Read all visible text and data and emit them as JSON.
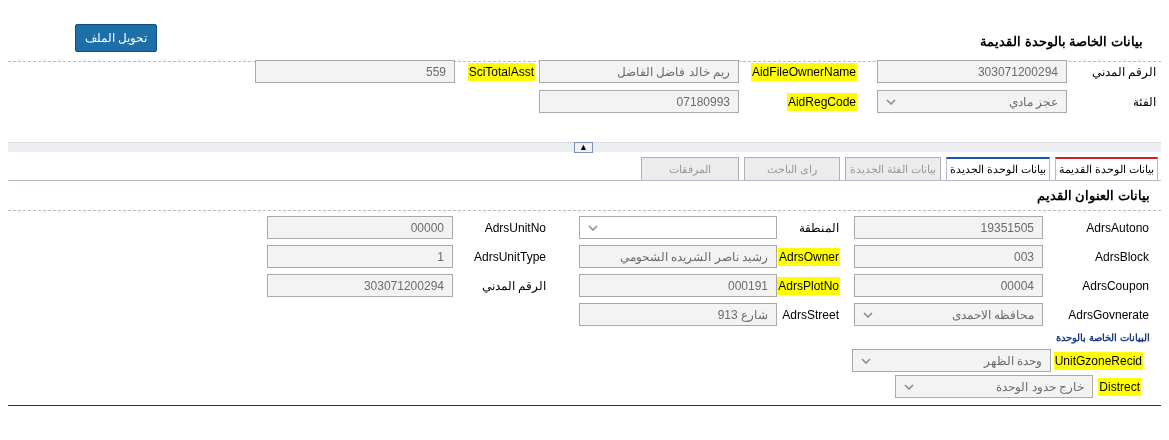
{
  "header": {
    "title": "بيانات الخاصة بالوحدة القديمة",
    "button": "تحويل الملف"
  },
  "top_rows": [
    [
      {
        "label": "الرقم المدني",
        "highlighted": false,
        "kind": "text",
        "value": "303071200294",
        "disabled": true
      },
      {
        "label": "AidFileOwnerName",
        "highlighted": true,
        "kind": "text",
        "value": "ريم خالد فاضل الفاضل",
        "disabled": true
      },
      {
        "label": "SciTotalAsst",
        "highlighted": true,
        "kind": "text",
        "value": "559",
        "disabled": true
      }
    ],
    [
      {
        "label": "الفئة",
        "highlighted": false,
        "kind": "select",
        "value": "عجز مادي",
        "disabled": true
      },
      {
        "label": "AidRegCode",
        "highlighted": true,
        "kind": "text",
        "value": "07180993",
        "disabled": true
      }
    ]
  ],
  "splitter_button": "▲",
  "tabs": [
    {
      "label": "بيانات الوحدة القديمة",
      "selected": true,
      "disabled": false
    },
    {
      "label": "بيانات الوحدة الجديدة",
      "selected": false,
      "disabled": false
    },
    {
      "label": "بيانات الفئة الجديدة",
      "selected": false,
      "disabled": true
    },
    {
      "label": "راى الباحث",
      "selected": false,
      "disabled": true
    },
    {
      "label": "المرفقات",
      "selected": false,
      "disabled": true
    }
  ],
  "section_title": "بيانات العنوان القديم",
  "address_rows": [
    [
      {
        "label": "AdrsAutono",
        "highlighted": false,
        "kind": "text",
        "value": "19351505",
        "disabled": true
      },
      {
        "label": "المنطقة",
        "highlighted": false,
        "kind": "select",
        "disabled": false
      },
      {
        "label": "AdrsUnitNo",
        "highlighted": false,
        "kind": "text",
        "value": "00000",
        "disabled": true
      }
    ],
    [
      {
        "label": "AdrsBlock",
        "highlighted": false,
        "kind": "text",
        "value": "003",
        "disabled": true
      },
      {
        "label": "AdrsOwner",
        "highlighted": true,
        "kind": "text",
        "value": "رشيد ناصر الشريده الشحومي",
        "disabled": true
      },
      {
        "label": "AdrsUnitType",
        "highlighted": false,
        "kind": "text",
        "value": "1",
        "disabled": true
      }
    ],
    [
      {
        "label": "AdrsCoupon",
        "highlighted": false,
        "kind": "text",
        "value": "00004",
        "disabled": true
      },
      {
        "label": "AdrsPlotNo",
        "highlighted": true,
        "kind": "text",
        "value": "000191",
        "disabled": true
      },
      {
        "label": "الرقم المدني",
        "highlighted": false,
        "kind": "text",
        "value": "303071200294",
        "disabled": true
      }
    ],
    [
      {
        "label": "AdrsGovnerate",
        "highlighted": false,
        "kind": "select",
        "value": "محافظه الاحمدى",
        "disabled": true
      },
      {
        "label": "AdrsStreet",
        "highlighted": false,
        "kind": "text",
        "value": "شارع 913",
        "disabled": true
      }
    ]
  ],
  "unit_caption": "البيانات الخاصة بالوحدة",
  "unit_rows": [
    {
      "label": "UnitGzoneRecid",
      "highlighted": true,
      "kind": "select",
      "value": "وحدة الظهر",
      "disabled": true
    },
    {
      "label": "Distrect",
      "highlighted": true,
      "kind": "select",
      "value": "خارج حدود الوحدة",
      "disabled": true
    }
  ]
}
